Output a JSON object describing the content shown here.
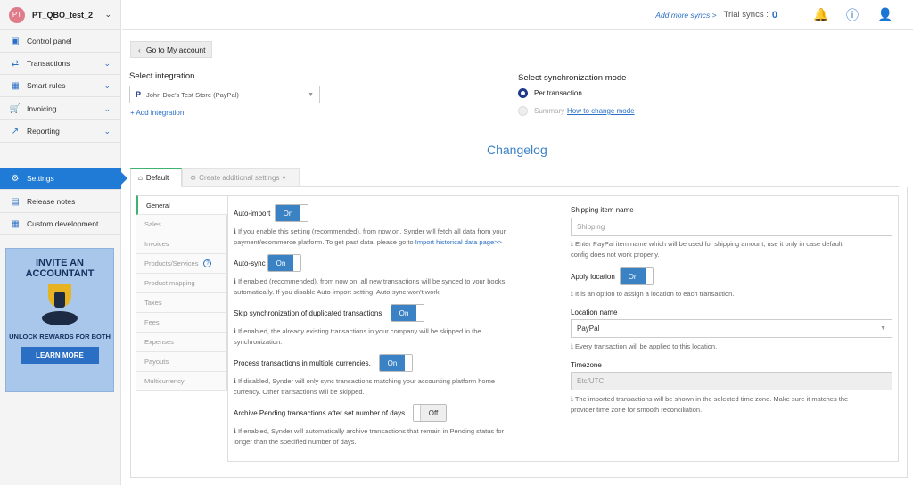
{
  "org": {
    "initials": "PT",
    "name": "PT_QBO_test_2"
  },
  "nav": [
    {
      "label": "Control panel",
      "icon": "dashboard-icon",
      "glyph": "▣",
      "dd": false
    },
    {
      "label": "Transactions",
      "icon": "transfer-icon",
      "glyph": "⇄",
      "dd": true
    },
    {
      "label": "Smart rules",
      "icon": "rules-icon",
      "glyph": "▦",
      "dd": true
    },
    {
      "label": "Invoicing",
      "icon": "cart-icon",
      "glyph": "🛒",
      "dd": true
    },
    {
      "label": "Reporting",
      "icon": "chart-icon",
      "glyph": "↗",
      "dd": true
    },
    {
      "label": "Settings",
      "icon": "gear-icon",
      "glyph": "⚙",
      "dd": false,
      "active": true
    },
    {
      "label": "Release notes",
      "icon": "notes-icon",
      "glyph": "▤",
      "dd": false
    },
    {
      "label": "Custom development",
      "icon": "code-icon",
      "glyph": "▦",
      "dd": false
    }
  ],
  "promo": {
    "title": "INVITE AN ACCOUNTANT",
    "subtitle": "UNLOCK REWARDS FOR BOTH",
    "button": "LEARN MORE"
  },
  "topbar": {
    "more": "Add more syncs >",
    "trial": "Trial syncs :",
    "count": "0"
  },
  "back": "Go to My account",
  "integration": {
    "label": "Select integration",
    "value": "John Doe's Test Store (PayPal)",
    "add": "+ Add integration"
  },
  "mode": {
    "label": "Select synchronization mode",
    "per": "Per transaction",
    "summary": "Summary",
    "how": "How to change mode"
  },
  "changelog": "Changelog",
  "tabs": {
    "default": "Default",
    "create": "Create additional settings"
  },
  "subnav": [
    "General",
    "Sales",
    "Invoices",
    "Products/Services",
    "Product mapping",
    "Taxes",
    "Fees",
    "Expenses",
    "Payouts",
    "Multicurrency"
  ],
  "settings": {
    "autoimport": {
      "label": "Auto-import",
      "state": "On",
      "help1": "If you enable this setting (recommended), from now on, Synder will fetch all data from your",
      "help2": "payment/ecommerce platform. To get past data, please go to ",
      "link": "Import historical data page>>"
    },
    "autosync": {
      "label": "Auto-sync",
      "state": "On",
      "help1": "If enabled (recommended), from now on, all new transactions will be synced to your books",
      "help2": "automatically. If you disable Auto-import setting, Auto-sync won't work."
    },
    "skipdup": {
      "label": "Skip synchronization of duplicated transactions",
      "state": "On",
      "help1": "If enabled, the already existing transactions in your company will be skipped in the",
      "help2": "synchronization."
    },
    "multicur": {
      "label": "Process transactions in multiple currencies.",
      "state": "On",
      "help1": "If disabled, Synder will only sync transactions matching your accounting platform home",
      "help2": "currency. Other transactions will be skipped."
    },
    "archive": {
      "label": "Archive Pending transactions after set number of days",
      "state": "Off",
      "help1": "If enabled, Synder will automatically archive transactions that remain in Pending status for",
      "help2": "longer than the specified number of days."
    },
    "shipping": {
      "label": "Shipping item name",
      "placeholder": "Shipping",
      "help1": "Enter PayPal item name which will be used for shipping amount, use it only in case default",
      "help2": "config does not work properly."
    },
    "applyloc": {
      "label": "Apply location",
      "state": "On",
      "help": "It is an option to assign a location to each transaction."
    },
    "location": {
      "label": "Location name",
      "value": "PayPal",
      "help": "Every transaction will be applied to this location."
    },
    "timezone": {
      "label": "Timezone",
      "value": "Etc/UTC",
      "help1": "The imported transactions will be shown in the selected time zone. Make sure it matches the",
      "help2": "provider time zone for smooth reconciliation."
    }
  }
}
